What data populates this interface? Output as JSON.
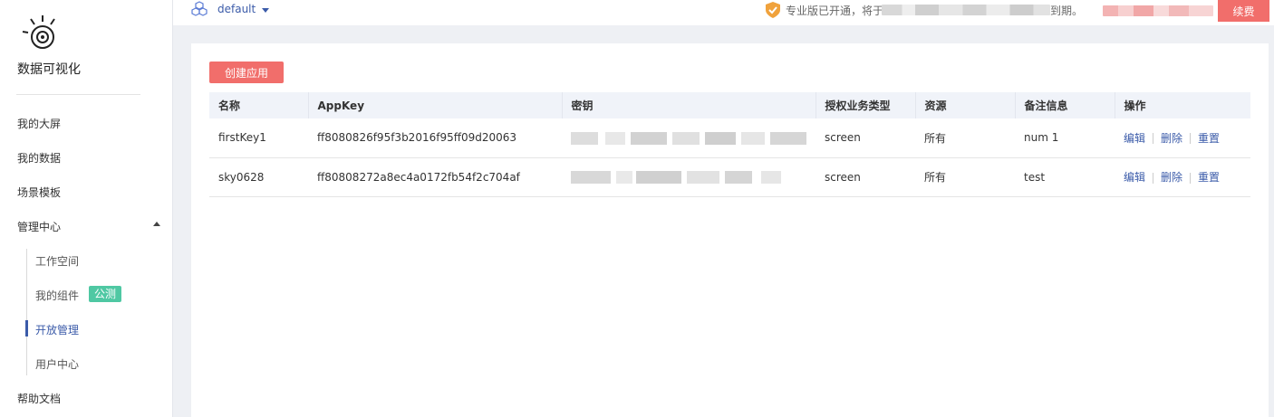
{
  "sidebar": {
    "brand": "数据可视化",
    "nav": {
      "my_screens": "我的大屏",
      "my_data": "我的数据",
      "templates": "场景模板",
      "management": "管理中心",
      "help": "帮助文档"
    },
    "sub": {
      "workspace": "工作空间",
      "my_components": "我的组件",
      "beta_badge": "公测",
      "open_management": "开放管理",
      "user_center": "用户中心"
    },
    "active_sub": "open_management"
  },
  "topbar": {
    "workspace": "default",
    "notice_prefix": "专业版已开通，将于",
    "notice_suffix": "到期。",
    "renew": "续费"
  },
  "content": {
    "create_button": "创建应用",
    "columns": [
      "名称",
      "AppKey",
      "密钥",
      "授权业务类型",
      "资源",
      "备注信息",
      "操作"
    ],
    "rows": [
      {
        "name": "firstKey1",
        "appkey": "ff8080826f95f3b2016f95ff09d20063",
        "type": "screen",
        "resource": "所有",
        "remark": "num 1"
      },
      {
        "name": "sky0628",
        "appkey": "ff80808272a8ec4a0172fb54f2c704af",
        "type": "screen",
        "resource": "所有",
        "remark": "test"
      }
    ],
    "actions": {
      "edit": "编辑",
      "delete": "删除",
      "reset": "重置"
    }
  },
  "colors": {
    "accent": "#3b5ba9",
    "primary_button": "#f16e6b",
    "badge": "#4fc8a3",
    "header_bg": "#f0f3f9",
    "page_bg": "#eef0f4"
  }
}
